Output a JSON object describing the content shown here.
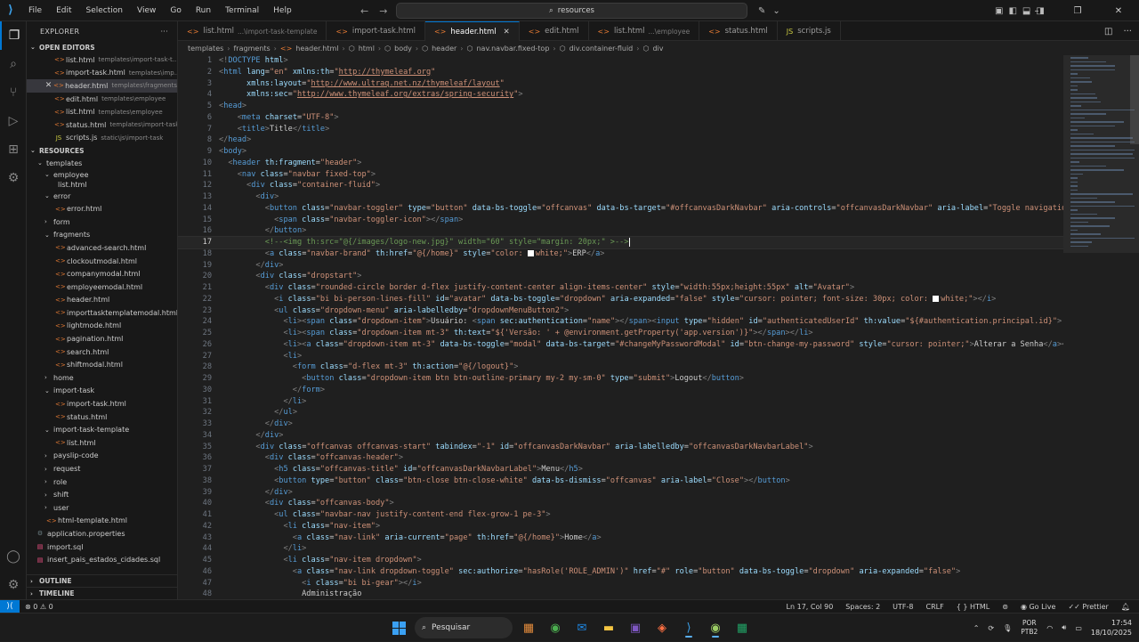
{
  "menu": [
    "File",
    "Edit",
    "Selection",
    "View",
    "Go",
    "Run",
    "Terminal",
    "Help"
  ],
  "search": {
    "text": "resources"
  },
  "sidebar": {
    "title": "EXPLORER",
    "open_editors_label": "OPEN EDITORS",
    "open_editors": [
      {
        "name": "list.html",
        "desc": "templates\\import-task-t..."
      },
      {
        "name": "import-task.html",
        "desc": "templates\\imp..."
      },
      {
        "name": "header.html",
        "desc": "templates\\fragments"
      },
      {
        "name": "edit.html",
        "desc": "templates\\employee"
      },
      {
        "name": "list.html",
        "desc": "templates\\employee"
      },
      {
        "name": "status.html",
        "desc": "templates\\import-task"
      },
      {
        "name": "scripts.js",
        "desc": "static\\js\\import-task"
      }
    ],
    "resources_label": "RESOURCES",
    "tree": {
      "templates": "templates",
      "employee": "employee",
      "employee_list": "list.html",
      "error": "error",
      "error_file": "error.html",
      "form": "form",
      "fragments": "fragments",
      "fragment_files": [
        "advanced-search.html",
        "clockoutmodal.html",
        "companymodal.html",
        "employeemodal.html",
        "header.html",
        "importtasktemplatemodal.html",
        "lightmode.html",
        "pagination.html",
        "search.html",
        "shiftmodal.html"
      ],
      "home": "home",
      "import_task": "import-task",
      "import_task_files": [
        "import-task.html",
        "status.html"
      ],
      "import_task_template": "import-task-template",
      "itt_list": "list.html",
      "folders_after": [
        "payslip-code",
        "request",
        "role",
        "shift",
        "user"
      ],
      "html_template": "html-template.html",
      "root_files": [
        "application.properties",
        "import.sql",
        "insert_pais_estados_cidades.sql"
      ]
    },
    "outline_label": "OUTLINE",
    "timeline_label": "TIMELINE"
  },
  "tabs": [
    {
      "name": "list.html",
      "desc": "...\\import-task-template"
    },
    {
      "name": "import-task.html",
      "desc": ""
    },
    {
      "name": "header.html",
      "desc": ""
    },
    {
      "name": "edit.html",
      "desc": ""
    },
    {
      "name": "list.html",
      "desc": "...\\employee"
    },
    {
      "name": "status.html",
      "desc": ""
    },
    {
      "name": "scripts.js",
      "desc": ""
    }
  ],
  "breadcrumbs": [
    "templates",
    "fragments",
    "header.html",
    "html",
    "body",
    "header",
    "nav.navbar.fixed-top",
    "div.container-fluid",
    "div"
  ],
  "status": {
    "errors": "0",
    "warnings": "0",
    "position": "Ln 17, Col 90",
    "spaces": "Spaces: 2",
    "encoding": "UTF-8",
    "eol": "CRLF",
    "language": "HTML",
    "golive": "Go Live",
    "prettier": "Prettier"
  },
  "taskbar": {
    "search": "Pesquisar",
    "lang1": "POR",
    "lang2": "PTB2",
    "time": "17:54",
    "date": "18/10/2025"
  }
}
